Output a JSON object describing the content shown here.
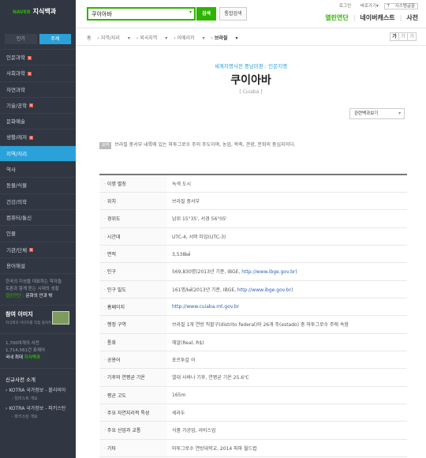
{
  "header": {
    "brand": "NAVER",
    "service": "지식백과",
    "search_value": "쿠이아바",
    "search_button": "검색",
    "advanced_button": "통합검색",
    "util": [
      "로그인",
      "바로가기",
      "시스템글꼴"
    ],
    "nav": [
      "열린연단",
      "네이버캐스트",
      "사전"
    ]
  },
  "sidebar": {
    "tabs": [
      "인기",
      "주제"
    ],
    "items": [
      {
        "label": "인문과학",
        "new": true
      },
      {
        "label": "사회과학",
        "new": true
      },
      {
        "label": "자연과학",
        "new": false
      },
      {
        "label": "기술/공학",
        "new": true
      },
      {
        "label": "문화예술",
        "new": false
      },
      {
        "label": "생활/레저",
        "new": true
      },
      {
        "label": "지역/지리",
        "new": false,
        "active": true
      },
      {
        "label": "역사",
        "new": false
      },
      {
        "label": "동물/식물",
        "new": false
      },
      {
        "label": "건강/의학",
        "new": false
      },
      {
        "label": "컴퓨터/통신",
        "new": false
      },
      {
        "label": "인물",
        "new": false
      },
      {
        "label": "기관/단체",
        "new": true
      },
      {
        "label": "용어해설",
        "new": false
      }
    ],
    "promo": [
      "한국의 지성을 대표하는 학자들",
      "토론과 함께 듣는 시대의 성찰",
      "열린연단",
      "문화의 안과 밖"
    ],
    "join_title": "참여 이미지",
    "join_sub": "지식백과 이미지를 직접 올려주세요",
    "counts": [
      "1,700여개의 사전",
      "1,714,561건 표제어",
      "국내 최대",
      "지식백과"
    ],
    "new_title": "신규사전 소개",
    "new_items": [
      {
        "title": "KOTRA 국가정보 - 볼리비아",
        "sub": "- 일러스트 개요"
      },
      {
        "title": "KOTRA 국가정보 - 파키스탄",
        "sub": "- 파키스탄 개요"
      }
    ]
  },
  "breadcrumb": [
    "홈",
    "지역/지리",
    "외국지역",
    "아메리카",
    "브라질"
  ],
  "font_controls": [
    "가",
    "가",
    "가"
  ],
  "entry": {
    "source": "세계지명사전 중남미편 : 인문지명",
    "title": "쿠이아바",
    "original": "[ Cuiabá ]",
    "more_menu": "관련백과보기",
    "def_label": "요약",
    "definition": "브라질 중서부 내륙에 있는 마투그로수 주의 주도이며, 농업, 목축, 관광, 문화의 중심지이다.",
    "rows": [
      {
        "key": "이명 별칭",
        "value": "녹색 도시"
      },
      {
        "key": "위치",
        "value": "브라질 중서부"
      },
      {
        "key": "경위도",
        "value": "남위 15°35', 서경 56°05'"
      },
      {
        "key": "시간대",
        "value": "UTC-4, 서머 타임(UTC-3)"
      },
      {
        "key": "면적",
        "value": "3,538㎢"
      },
      {
        "key": "인구",
        "value": "569,830명(2013년 기준, IBGE, ",
        "link": "http://www.ibge.gov.br",
        "tail": ")"
      },
      {
        "key": "인구 밀도",
        "value": "161명/㎢(2013년 기준, IBGE, ",
        "link": "http://www.ibge.gov.br",
        "tail": ")"
      },
      {
        "key": "홈페이지",
        "value": "",
        "link": "http://www.cuiaba.mt.gov.br",
        "tail": ""
      },
      {
        "key": "행정 구역",
        "value": "브라질 1개 연방 직할구(distrito federal)와 26개 주(estado) 중 마투그로수 주에 속함"
      },
      {
        "key": "통화",
        "value": "헤알(Real, R$)"
      },
      {
        "key": "공용어",
        "value": "포르투갈 어"
      },
      {
        "key": "기후와 연평균 기온",
        "value": "열대 사바나 기후, 연평균 기온 25.6℃"
      },
      {
        "key": "평균 고도",
        "value": "165m"
      },
      {
        "key": "주요 자연지리적 특성",
        "value": "세라두"
      },
      {
        "key": "주요 산업과 교통",
        "value": "식품 가공업, 서비스업"
      },
      {
        "key": "기타",
        "value": "마투그로수 연방대학교, 2014 피파 월드컵"
      }
    ]
  }
}
